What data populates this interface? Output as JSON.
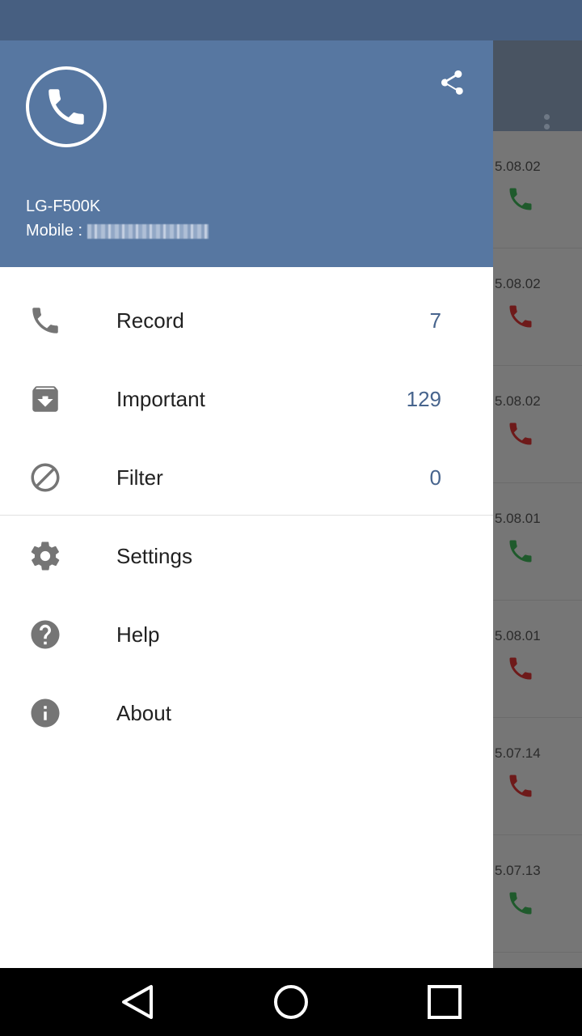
{
  "background": {
    "rows": [
      {
        "date": "5.08.02",
        "call_color": "#1f5a2c"
      },
      {
        "date": "5.08.02",
        "call_color": "#6e1a1a"
      },
      {
        "date": "5.08.02",
        "call_color": "#6e1a1a"
      },
      {
        "date": "5.08.01",
        "call_color": "#1f5a2c"
      },
      {
        "date": "5.08.01",
        "call_color": "#6e1a1a"
      },
      {
        "date": "5.07.14",
        "call_color": "#6e1a1a"
      },
      {
        "date": "5.07.13",
        "call_color": "#1f5a2c"
      }
    ]
  },
  "drawer": {
    "header": {
      "logo_icon": "phone-icon",
      "share_icon": "share-icon",
      "device_name": "LG-F500K",
      "mobile_label": "Mobile :",
      "mobile_number_redacted": true
    },
    "items": [
      {
        "icon": "phone-icon",
        "label": "Record",
        "count": "7"
      },
      {
        "icon": "archive-icon",
        "label": "Important",
        "count": "129"
      },
      {
        "icon": "block-icon",
        "label": "Filter",
        "count": "0"
      },
      {
        "icon": "gear-icon",
        "label": "Settings",
        "count": ""
      },
      {
        "icon": "help-icon",
        "label": "Help",
        "count": ""
      },
      {
        "icon": "info-icon",
        "label": "About",
        "count": ""
      }
    ]
  },
  "colors": {
    "header": "#5777a1",
    "accent_count": "#47648d",
    "status_bar": "#475f81"
  },
  "nav_bar": {
    "back_icon": "back-triangle-icon",
    "home_icon": "home-circle-icon",
    "recents_icon": "recents-square-icon"
  }
}
